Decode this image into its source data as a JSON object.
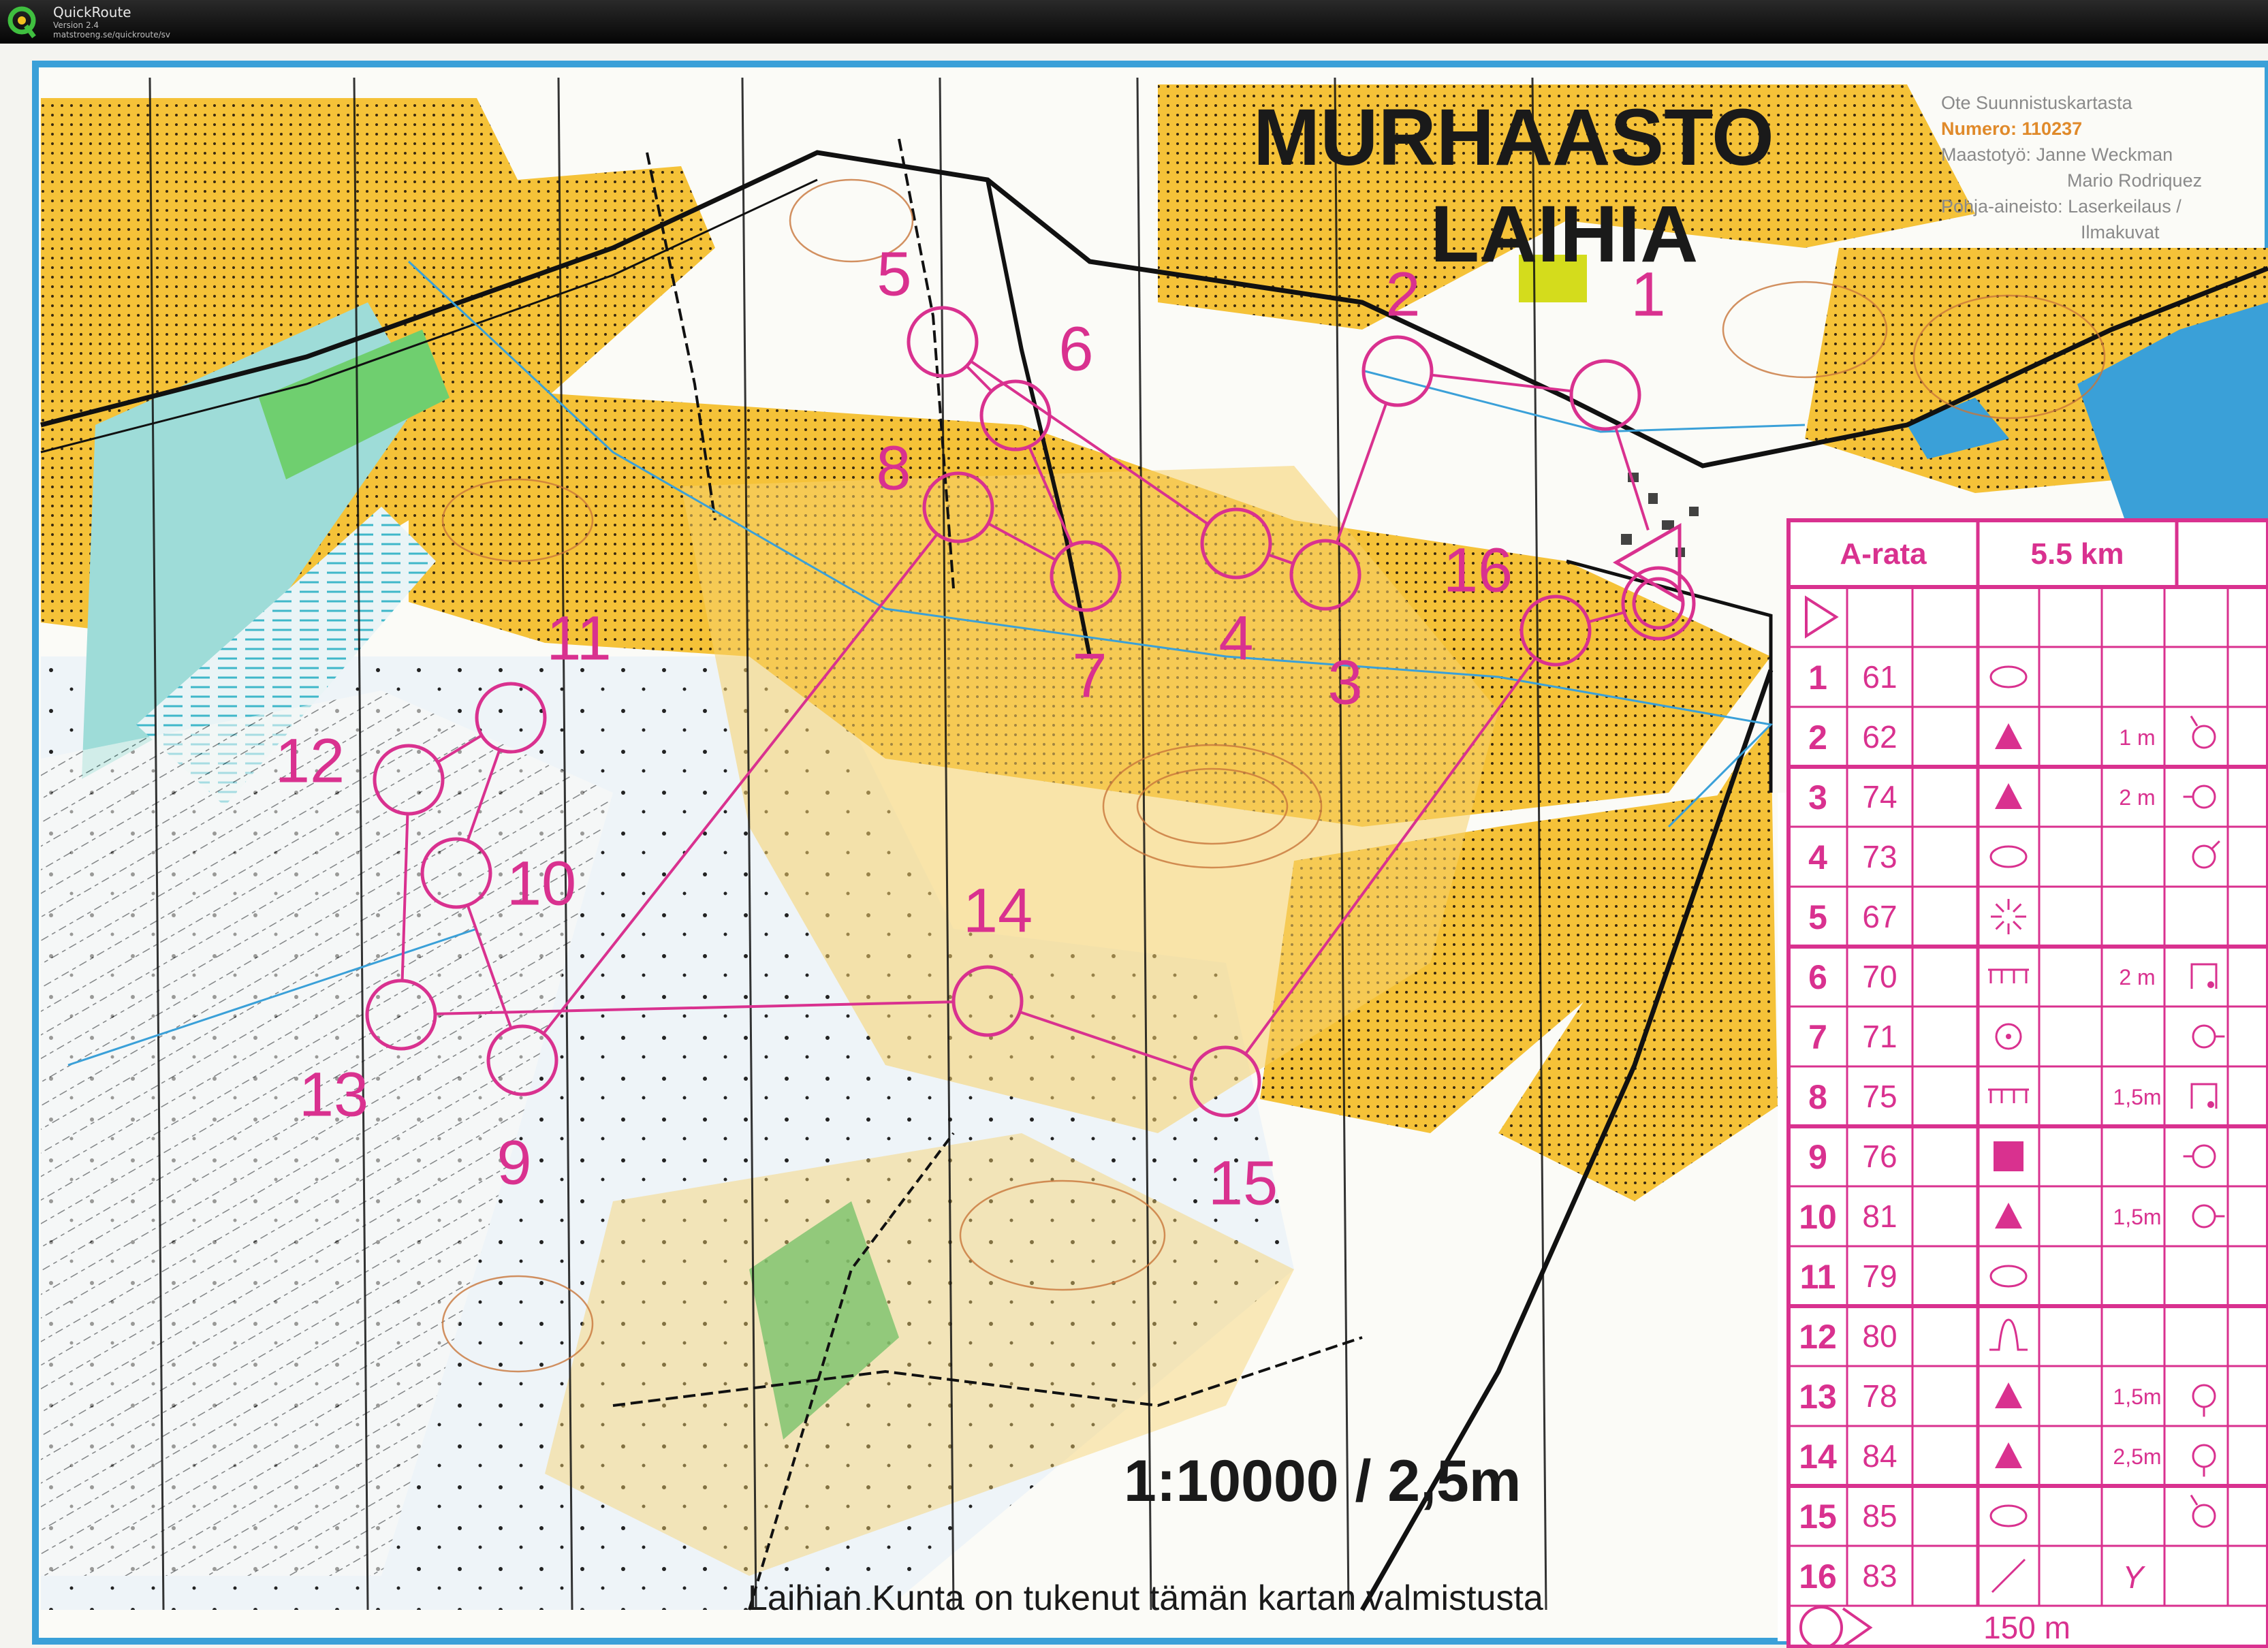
{
  "window": {
    "title": "QuickRoute",
    "version": "Version 2.4",
    "url": "matstroeng.se/quickroute/sv"
  },
  "map": {
    "title": "MURHAASTO",
    "subtitle": "LAIHIA",
    "info_lines": [
      "Ote Suunnistuskartasta",
      "Maastotyö:   Janne Weckman",
      "Mario Rodriquez",
      "Pohja-aineisto: Laserkeilaus /",
      "Ilmakuvat"
    ],
    "number_label": "Numero: 110237",
    "scale": "1:10000 / 2,5m",
    "credit": "Laihian Kunta on tukenut tämän kartan valmistusta",
    "colors": {
      "course": "#d9318f",
      "open_land": "#f5c238",
      "forest": "#ffffff",
      "marsh": "#6fd0d8",
      "green": "#79c26b"
    }
  },
  "course": {
    "controls": [
      {
        "id": "1"
      },
      {
        "id": "2"
      },
      {
        "id": "3"
      },
      {
        "id": "4"
      },
      {
        "id": "5"
      },
      {
        "id": "6"
      },
      {
        "id": "7"
      },
      {
        "id": "8"
      },
      {
        "id": "9"
      },
      {
        "id": "10"
      },
      {
        "id": "11"
      },
      {
        "id": "12"
      },
      {
        "id": "13"
      },
      {
        "id": "14"
      },
      {
        "id": "15"
      },
      {
        "id": "16"
      }
    ]
  },
  "descriptions": {
    "course_name": "A-rata",
    "length": "5.5 km",
    "rows": [
      {
        "num": "1",
        "code": "61",
        "symbol": "ellipse",
        "dim": "",
        "extra": ""
      },
      {
        "num": "2",
        "code": "62",
        "symbol": "triangle",
        "dim": "1 m",
        "extra": "foot-top"
      },
      {
        "num": "3",
        "code": "74",
        "symbol": "triangle",
        "dim": "2 m",
        "extra": "foot-left"
      },
      {
        "num": "4",
        "code": "73",
        "symbol": "ellipse",
        "dim": "",
        "extra": "foot-rightup"
      },
      {
        "num": "5",
        "code": "67",
        "symbol": "spark",
        "dim": "",
        "extra": ""
      },
      {
        "num": "6",
        "code": "70",
        "symbol": "comb",
        "dim": "2 m",
        "extra": "corner"
      },
      {
        "num": "7",
        "code": "71",
        "symbol": "dot-circle",
        "dim": "",
        "extra": "foot-right"
      },
      {
        "num": "8",
        "code": "75",
        "symbol": "comb",
        "dim": "1,5m",
        "extra": "corner"
      },
      {
        "num": "9",
        "code": "76",
        "symbol": "square",
        "dim": "",
        "extra": "foot-left"
      },
      {
        "num": "10",
        "code": "81",
        "symbol": "triangle",
        "dim": "1,5m",
        "extra": "foot-right"
      },
      {
        "num": "11",
        "code": "79",
        "symbol": "ellipse",
        "dim": "",
        "extra": ""
      },
      {
        "num": "12",
        "code": "80",
        "symbol": "bell",
        "dim": "",
        "extra": ""
      },
      {
        "num": "13",
        "code": "78",
        "symbol": "triangle",
        "dim": "1,5m",
        "extra": "foot-bottom"
      },
      {
        "num": "14",
        "code": "84",
        "symbol": "triangle",
        "dim": "2,5m",
        "extra": "foot-bottom"
      },
      {
        "num": "15",
        "code": "85",
        "symbol": "ellipse",
        "dim": "",
        "extra": "foot-top"
      },
      {
        "num": "16",
        "code": "83",
        "symbol": "slash",
        "dim": "Y",
        "extra": ""
      }
    ],
    "footer_distance": "150 m"
  }
}
